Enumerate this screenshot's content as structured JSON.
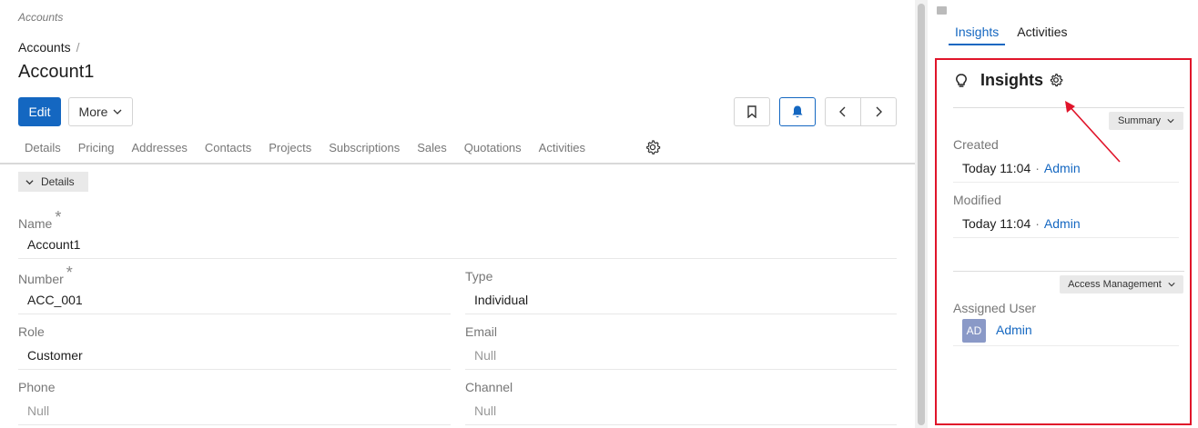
{
  "breadcrumb_top": "Accounts",
  "breadcrumb": {
    "label": "Accounts",
    "sep": "/"
  },
  "page_title": "Account1",
  "actions": {
    "edit": "Edit",
    "more": "More"
  },
  "tabs": [
    "Details",
    "Pricing",
    "Addresses",
    "Contacts",
    "Projects",
    "Subscriptions",
    "Sales",
    "Quotations",
    "Activities"
  ],
  "panel": {
    "title": "Details"
  },
  "fields": {
    "name": {
      "label": "Name",
      "value": "Account1",
      "required": "*"
    },
    "number": {
      "label": "Number",
      "value": "ACC_001",
      "required": "*"
    },
    "type": {
      "label": "Type",
      "value": "Individual"
    },
    "role": {
      "label": "Role",
      "value": "Customer"
    },
    "email": {
      "label": "Email",
      "value": "Null"
    },
    "phone": {
      "label": "Phone",
      "value": "Null"
    },
    "channel": {
      "label": "Channel",
      "value": "Null"
    }
  },
  "side": {
    "tabs": [
      "Insights",
      "Activities"
    ],
    "insights_title": "Insights",
    "summary_pill": "Summary",
    "created_label": "Created",
    "created_time": "Today 11:04",
    "created_by": "Admin",
    "modified_label": "Modified",
    "modified_time": "Today 11:04",
    "modified_by": "Admin",
    "separator": "·",
    "access_pill": "Access Management",
    "assigned_label": "Assigned User",
    "assigned_initials": "AD",
    "assigned_name": "Admin"
  },
  "colors": {
    "accent": "#1467c1",
    "highlight": "#e0142a"
  }
}
